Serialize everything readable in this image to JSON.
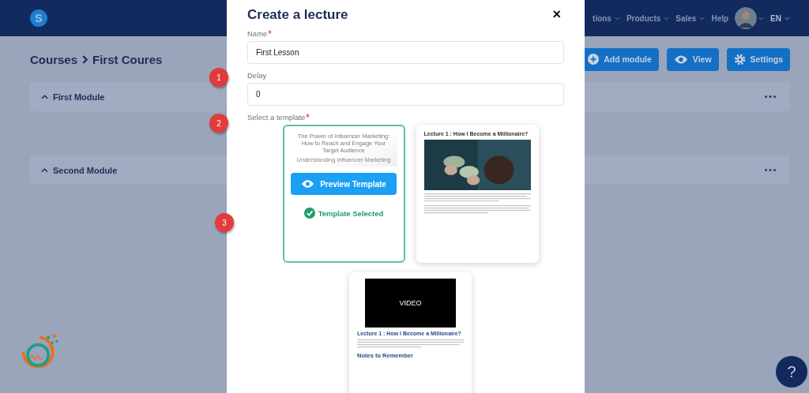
{
  "header": {
    "logo": "S",
    "nav": [
      {
        "label": "tions",
        "dropdown": true
      },
      {
        "label": "Products",
        "dropdown": true
      },
      {
        "label": "Sales",
        "dropdown": true
      },
      {
        "label": "Help",
        "dropdown": false
      }
    ],
    "language": "EN"
  },
  "breadcrumb": [
    "Courses",
    "First Coures"
  ],
  "actions": [
    {
      "kind": "add",
      "label": "Add module"
    },
    {
      "kind": "view",
      "label": "View"
    },
    {
      "kind": "settings",
      "label": "Settings"
    }
  ],
  "modules": [
    {
      "title": "First Module",
      "expanded": true
    },
    {
      "title": "Second Module",
      "expanded": true
    }
  ],
  "modal": {
    "title": "Create a lecture",
    "close": "×",
    "fields": [
      {
        "label": "Name",
        "required": true,
        "value": "First Lesson"
      },
      {
        "label": "Delay",
        "required": false,
        "value": "0"
      }
    ],
    "template_label": "Select a template",
    "template_required": true,
    "templates": [
      {
        "kind": "article",
        "selected": true,
        "heading": "The Power of Influencer Marketing: How to Reach and Engage Your Target Audience",
        "subheading": "Understanding Influencer Marketing"
      },
      {
        "selected": false,
        "heading": "Lecture 1 : How I Become a Millionaire?"
      },
      {
        "kind": "video",
        "selected": false,
        "video_label": "VIDEO",
        "heading": "Lecture 1 : How I Become a Millionaire?",
        "subheading": "Notes to Remember"
      }
    ],
    "preview_button": "Preview Template",
    "selected_label": "Template Selected"
  },
  "markers": [
    "1",
    "2",
    "3"
  ],
  "help": "?"
}
